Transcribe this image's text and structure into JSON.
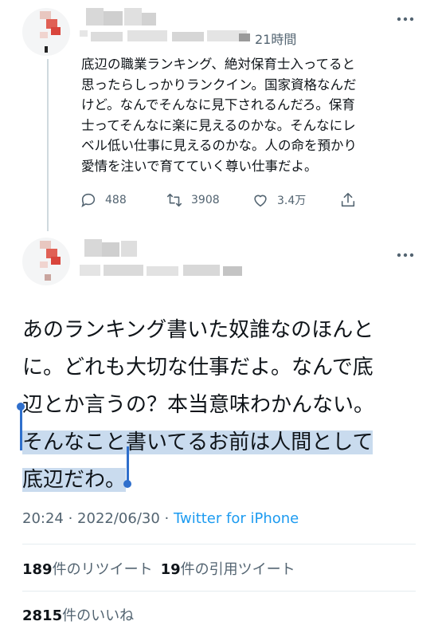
{
  "tweet1": {
    "time": "21時間",
    "text": "底辺の職業ランキング、絶対保育士入ってると\n思ったらしっかりランクイン。国家資格なんだ\nけど。なんでそんなに見下されるんだろ。保育\n士ってそんなに楽に見えるのかな。そんなにレ\nベル低い仕事に見えるのかな。人の命を預かり\n愛情を注いで育てていく尊い仕事だよ。",
    "replies": "488",
    "retweets": "3908",
    "likes": "3.4万"
  },
  "tweet2": {
    "lines": [
      "あのランキング書いた奴誰なのほんと",
      "に。どれも大切な仕事だよ。なんで底",
      "辺とか言うの？本当意味わかんない。"
    ],
    "selected_lines": [
      "そんなこと書いてるお前は人間として",
      "底辺だわ。"
    ],
    "timestamp": "20:24 · 2022/06/30 · ",
    "source": "Twitter for iPhone",
    "retweet_count": "189",
    "retweet_label": "件のリツイート",
    "quote_count": "19",
    "quote_label": "件の引用ツイート",
    "like_count": "2815",
    "like_label": "件のいいね"
  },
  "icons": [
    "reply-icon",
    "retweet-icon",
    "like-icon",
    "share-icon",
    "more-icon"
  ],
  "colors": {
    "selection": "#c9dbee",
    "handle": "#2f6fcc",
    "link": "#1d9bf0",
    "muted": "#536471"
  }
}
